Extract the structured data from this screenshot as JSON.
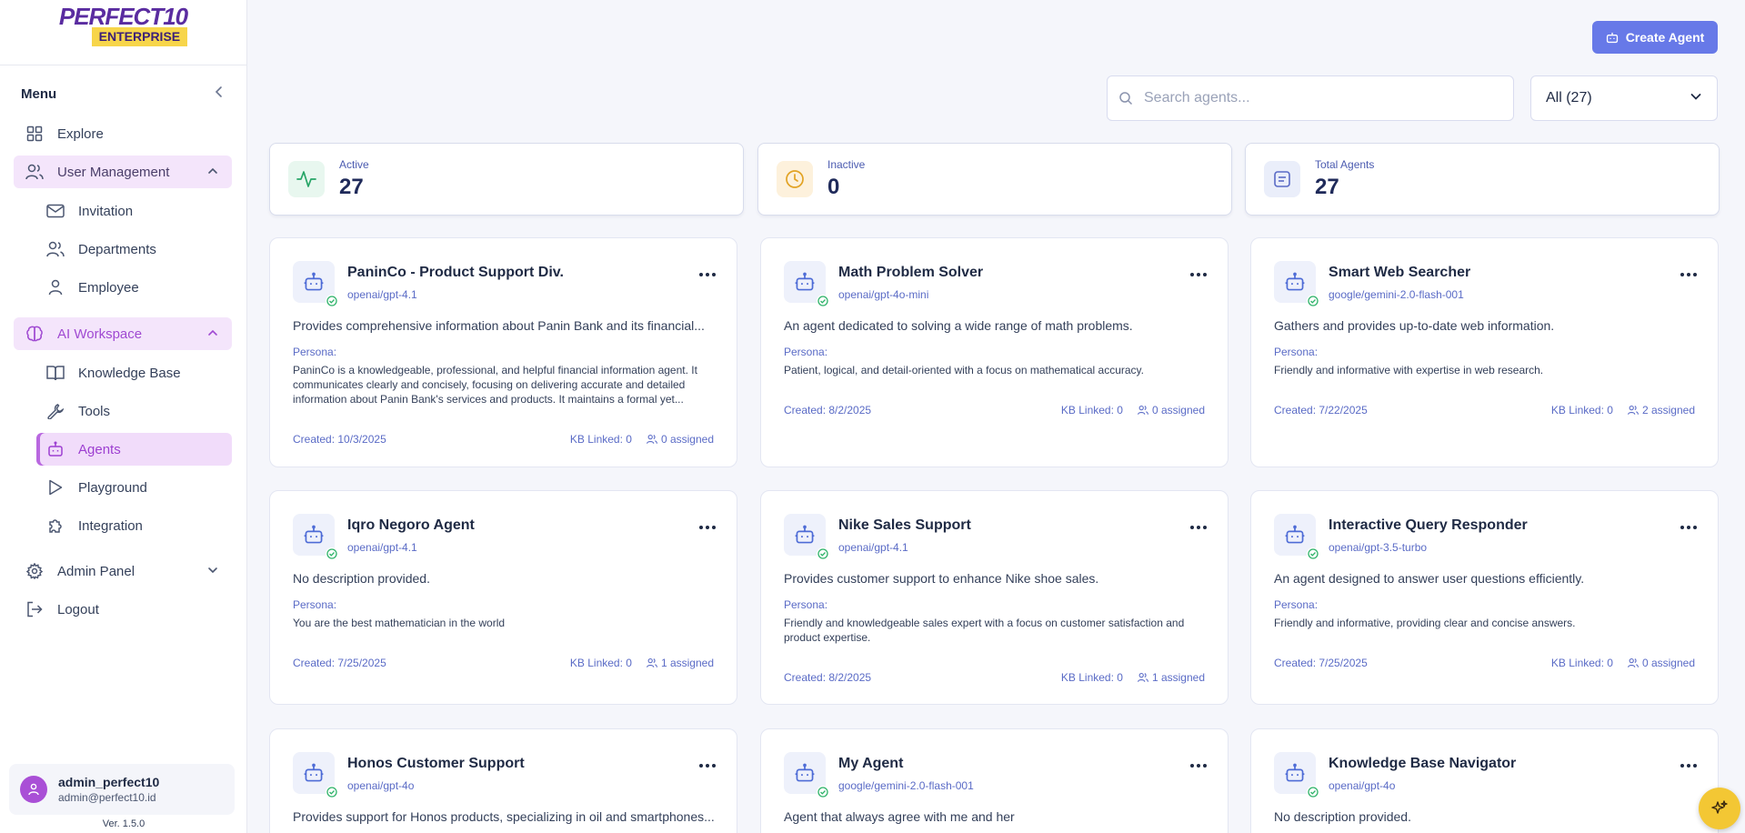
{
  "brand": {
    "main": "PERFECT10",
    "sub": "ENTERPRISE"
  },
  "sidebar": {
    "menu_label": "Menu",
    "items": {
      "explore": "Explore",
      "user_management": "User Management",
      "invitation": "Invitation",
      "departments": "Departments",
      "employee": "Employee",
      "ai_workspace": "AI Workspace",
      "knowledge_base": "Knowledge Base",
      "tools": "Tools",
      "agents": "Agents",
      "playground": "Playground",
      "integration": "Integration",
      "admin_panel": "Admin Panel",
      "logout": "Logout"
    },
    "user": {
      "name": "admin_perfect10",
      "email": "admin@perfect10.id"
    },
    "version": "Ver. 1.5.0"
  },
  "toolbar": {
    "create_label": "Create Agent",
    "search_placeholder": "Search agents...",
    "filter_value": "All (27)"
  },
  "stats": {
    "active": {
      "label": "Active",
      "value": "27"
    },
    "inactive": {
      "label": "Inactive",
      "value": "0"
    },
    "total": {
      "label": "Total Agents",
      "value": "27"
    }
  },
  "agents": [
    {
      "name": "PaninCo - Product Support Div.",
      "model": "openai/gpt-4.1",
      "description": "Provides comprehensive information about Panin Bank and its financial...",
      "persona_label": "Persona:",
      "persona": "PaninCo is a knowledgeable, professional, and helpful financial information agent. It communicates clearly and concisely, focusing on delivering accurate and detailed information about Panin Bank's services and products. It maintains a formal yet...",
      "created": "Created: 10/3/2025",
      "kb": "KB Linked: 0",
      "assigned": "0 assigned"
    },
    {
      "name": "Math Problem Solver",
      "model": "openai/gpt-4o-mini",
      "description": "An agent dedicated to solving a wide range of math problems.",
      "persona_label": "Persona:",
      "persona": "Patient, logical, and detail-oriented with a focus on mathematical accuracy.",
      "created": "Created: 8/2/2025",
      "kb": "KB Linked: 0",
      "assigned": "0 assigned"
    },
    {
      "name": "Smart Web Searcher",
      "model": "google/gemini-2.0-flash-001",
      "description": "Gathers and provides up-to-date web information.",
      "persona_label": "Persona:",
      "persona": "Friendly and informative with expertise in web research.",
      "created": "Created: 7/22/2025",
      "kb": "KB Linked: 0",
      "assigned": "2 assigned"
    },
    {
      "name": "Iqro Negoro Agent",
      "model": "openai/gpt-4.1",
      "description": "No description provided.",
      "persona_label": "Persona:",
      "persona": "You are the best mathematician in the world",
      "created": "Created: 7/25/2025",
      "kb": "KB Linked: 0",
      "assigned": "1 assigned"
    },
    {
      "name": "Nike Sales Support",
      "model": "openai/gpt-4.1",
      "description": "Provides customer support to enhance Nike shoe sales.",
      "persona_label": "Persona:",
      "persona": "Friendly and knowledgeable sales expert with a focus on customer satisfaction and product expertise.",
      "created": "Created: 8/2/2025",
      "kb": "KB Linked: 0",
      "assigned": "1 assigned"
    },
    {
      "name": "Interactive Query Responder",
      "model": "openai/gpt-3.5-turbo",
      "description": "An agent designed to answer user questions efficiently.",
      "persona_label": "Persona:",
      "persona": "Friendly and informative, providing clear and concise answers.",
      "created": "Created: 7/25/2025",
      "kb": "KB Linked: 0",
      "assigned": "0 assigned"
    },
    {
      "name": "Honos Customer Support",
      "model": "openai/gpt-4o",
      "description": "Provides support for Honos products, specializing in oil and smartphones..."
    },
    {
      "name": "My Agent",
      "model": "google/gemini-2.0-flash-001",
      "description": "Agent that always agree with me and her"
    },
    {
      "name": "Knowledge Base Navigator",
      "model": "openai/gpt-4o",
      "description": "No description provided."
    }
  ]
}
